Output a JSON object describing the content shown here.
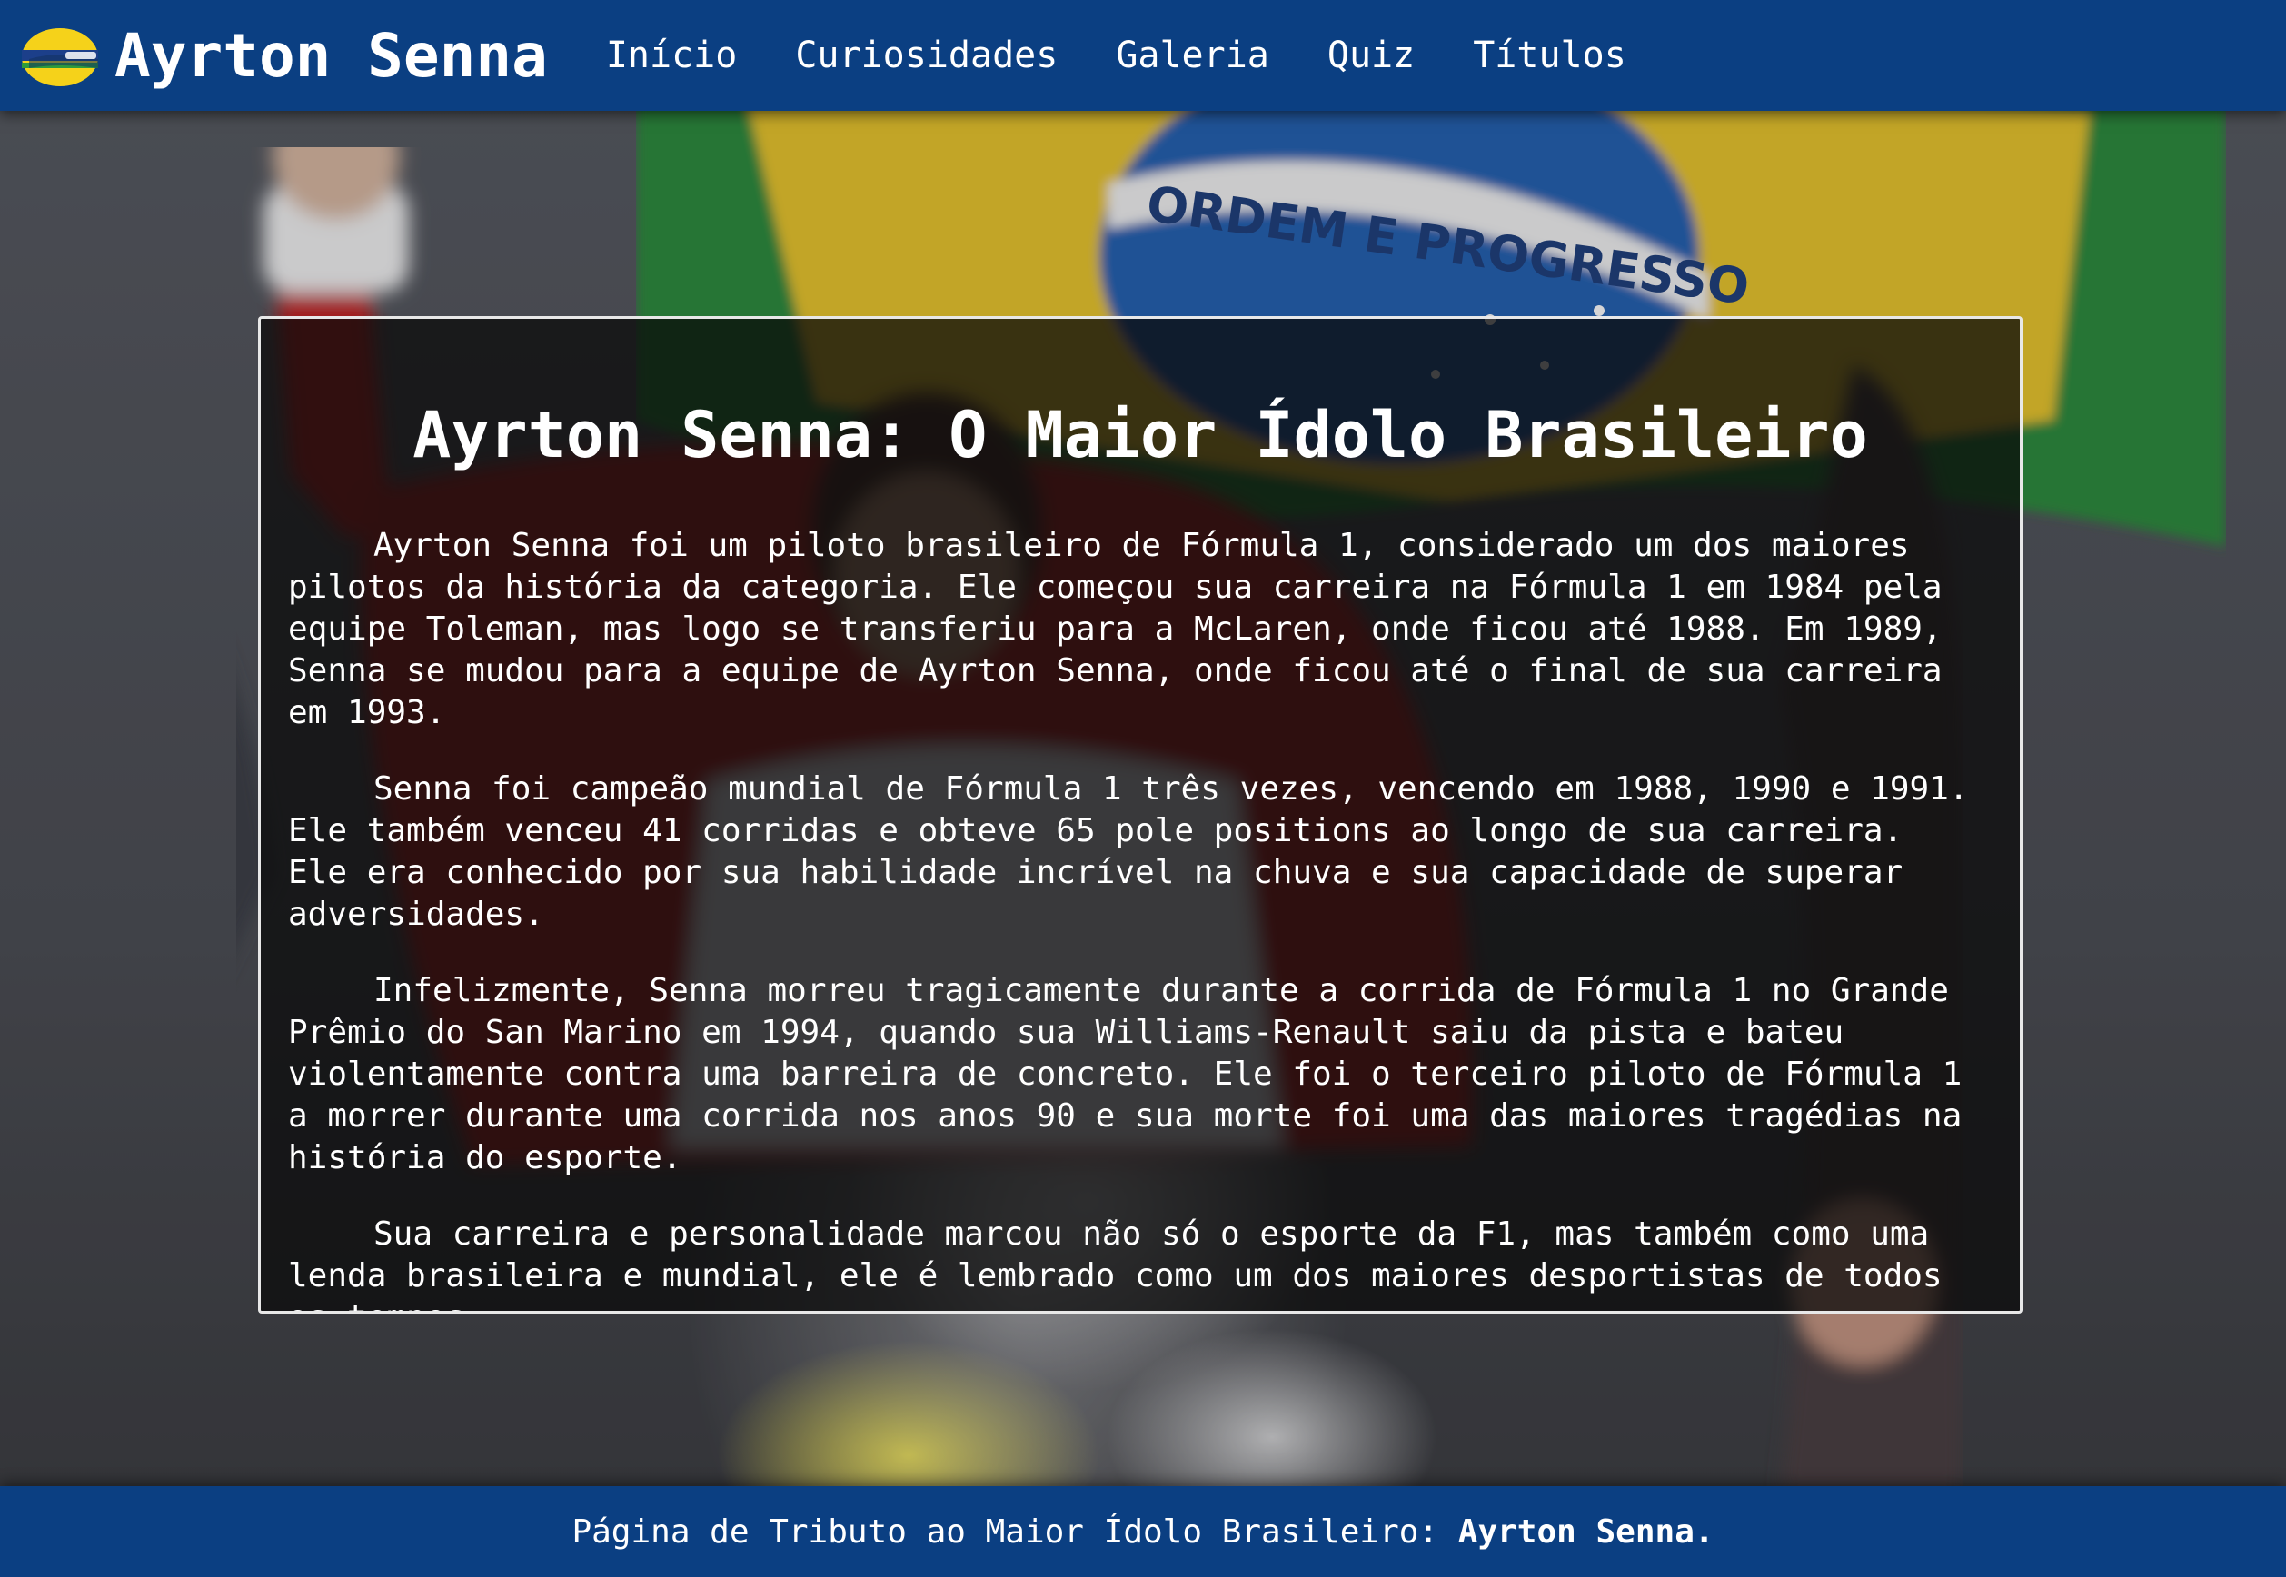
{
  "header": {
    "logo_icon": "senna-helmet-icon",
    "site_title": "Ayrton Senna",
    "nav": [
      {
        "label": "Início"
      },
      {
        "label": "Curiosidades"
      },
      {
        "label": "Galeria"
      },
      {
        "label": "Quiz"
      },
      {
        "label": "Títulos"
      }
    ]
  },
  "main": {
    "title": "Ayrton Senna: O Maior Ídolo Brasileiro",
    "paragraphs": [
      "Ayrton Senna foi um piloto brasileiro de Fórmula 1, considerado um dos maiores pilotos da história da categoria. Ele começou sua carreira na Fórmula 1 em 1984 pela equipe Toleman, mas logo se transferiu para a McLaren, onde ficou até 1988. Em 1989, Senna se mudou para a equipe de Ayrton Senna, onde ficou até o final de sua carreira em 1993.",
      "Senna foi campeão mundial de Fórmula 1 três vezes, vencendo em 1988, 1990 e 1991. Ele também venceu 41 corridas e obteve 65 pole positions ao longo de sua carreira. Ele era conhecido por sua habilidade incrível na chuva e sua capacidade de superar adversidades.",
      "Infelizmente, Senna morreu tragicamente durante a corrida de Fórmula 1 no Grande Prêmio do San Marino em 1994, quando sua Williams-Renault saiu da pista e bateu violentamente contra uma barreira de concreto. Ele foi o terceiro piloto de Fórmula 1 a morrer durante uma corrida nos anos 90 e sua morte foi uma das maiores tragédias na história do esporte.",
      "Sua carreira e personalidade marcou não só o esporte da F1, mas também como uma lenda brasileira e mundial, ele é lembrado como um dos maiores desportistas de todos os tempos."
    ]
  },
  "background": {
    "flag_motto": "ORDEM E PROGRESSO"
  },
  "footer": {
    "text": "Página de Tributo ao Maior Ídolo Brasileiro: ",
    "strong": "Ayrton Senna."
  },
  "colors": {
    "header_bg": "#0b3f82",
    "footer_bg": "#0b3f82",
    "card_bg": "rgba(10,10,10,0.74)",
    "text": "#ffffff"
  }
}
